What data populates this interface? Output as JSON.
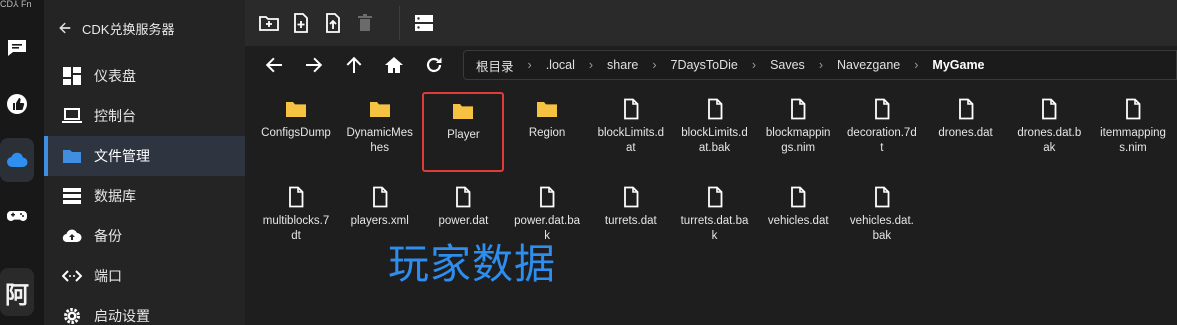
{
  "rail": {
    "logo_text": "CD⅄ Fn",
    "avatar_char": "阿"
  },
  "sidebar": {
    "header": "CDK兑换服务器",
    "items": [
      {
        "label": "仪表盘",
        "icon": "dashboard-icon"
      },
      {
        "label": "控制台",
        "icon": "laptop-icon"
      },
      {
        "label": "文件管理",
        "icon": "folder-icon"
      },
      {
        "label": "数据库",
        "icon": "database-icon"
      },
      {
        "label": "备份",
        "icon": "cloud-upload-icon"
      },
      {
        "label": "端口",
        "icon": "code-arrows-icon"
      },
      {
        "label": "启动设置",
        "icon": "gear-icon"
      }
    ],
    "active_index": 2
  },
  "breadcrumb": [
    "根目录",
    ".local",
    "share",
    "7DaysToDie",
    "Saves",
    "Navezgane",
    "MyGame"
  ],
  "files": [
    {
      "name": "ConfigsDump",
      "type": "folder"
    },
    {
      "name": "DynamicMeshes",
      "type": "folder"
    },
    {
      "name": "Player",
      "type": "folder",
      "selected": true
    },
    {
      "name": "Region",
      "type": "folder"
    },
    {
      "name": "blockLimits.dat",
      "type": "file"
    },
    {
      "name": "blockLimits.dat.bak",
      "type": "file"
    },
    {
      "name": "blockmappings.nim",
      "type": "file"
    },
    {
      "name": "decoration.7dt",
      "type": "file"
    },
    {
      "name": "drones.dat",
      "type": "file"
    },
    {
      "name": "drones.dat.bak",
      "type": "file"
    },
    {
      "name": "itemmappings.nim",
      "type": "file"
    },
    {
      "name": "multiblocks.7dt",
      "type": "file"
    },
    {
      "name": "players.xml",
      "type": "file"
    },
    {
      "name": "power.dat",
      "type": "file"
    },
    {
      "name": "power.dat.bak",
      "type": "file"
    },
    {
      "name": "turrets.dat",
      "type": "file"
    },
    {
      "name": "turrets.dat.bak",
      "type": "file"
    },
    {
      "name": "vehicles.dat",
      "type": "file"
    },
    {
      "name": "vehicles.dat.bak",
      "type": "file"
    }
  ],
  "overlay_text": "玩家数据",
  "colors": {
    "folder": "#f5c242",
    "accent": "#3f8ee0",
    "highlight_box": "#e03a3a",
    "overlay": "#2d8ef0"
  }
}
